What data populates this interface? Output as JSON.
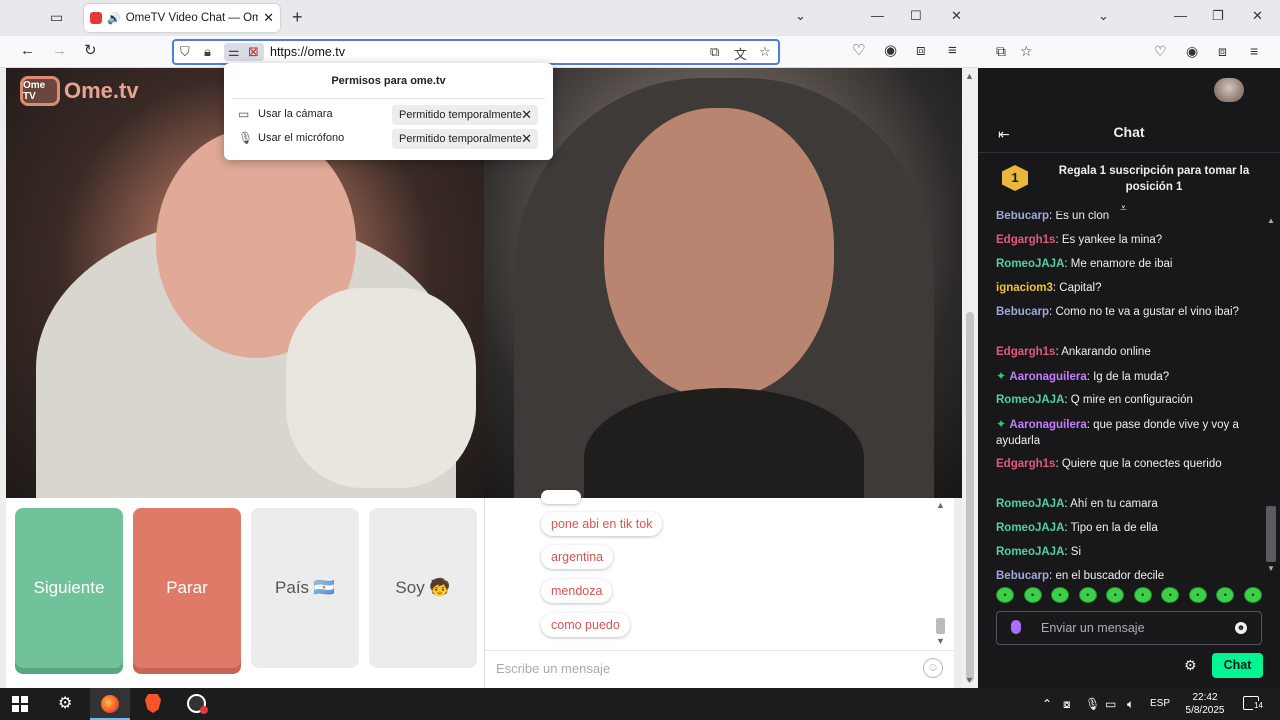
{
  "browser": {
    "tab_title": "OmeTV Video Chat — Ome",
    "url": "https://ome.tv"
  },
  "permissions_popup": {
    "title": "Permisos para ome.tv",
    "rows": [
      {
        "label": "Usar la cámara",
        "state": "Permitido temporalmente"
      },
      {
        "label": "Usar el micrófono",
        "state": "Permitido temporalmente"
      }
    ]
  },
  "ome": {
    "logo_badge": "Ome TV",
    "logo_text": "Ome.tv",
    "buttons": {
      "next": "Siguiente",
      "stop": "Parar",
      "country": "País 🇦🇷",
      "me": "Soy 🧒"
    },
    "chat_messages": [
      "pone abi en tik tok",
      "argentina",
      "mendoza",
      "como puedo"
    ],
    "chat_placeholder": "Escribe un mensaje"
  },
  "stream_chat": {
    "title": "Chat",
    "sub_banner_rank": "1",
    "sub_banner_text": "Regala 1 suscripción para tomar la posición 1",
    "messages": [
      {
        "user": "Bebucarp",
        "text": "Es un clon",
        "color": "#9fa8da",
        "badge": false
      },
      {
        "user": "Edgargh1s",
        "text": "Es yankee la mina?",
        "color": "#e05a7a",
        "badge": false
      },
      {
        "user": "RomeoJAJA",
        "text": "Me enamore de ibai",
        "color": "#4fd1a5",
        "badge": false
      },
      {
        "user": "ignaciom3",
        "text": "Capital?",
        "color": "#f1c232",
        "badge": false
      },
      {
        "user": "Bebucarp",
        "text": "Como no te va a gustar el vino ibai?",
        "color": "#9fa8da",
        "badge": false
      },
      {
        "user": "Edgargh1s",
        "text": "Ankarando online",
        "color": "#e05a7a",
        "badge": false
      },
      {
        "user": "Aaronaguilera",
        "text": "Ig de la muda?",
        "color": "#c77dff",
        "badge": true
      },
      {
        "user": "RomeoJAJA",
        "text": "Q mire en configuración",
        "color": "#4fd1a5",
        "badge": false
      },
      {
        "user": "Aaronaguilera",
        "text": "que pase donde vive y voy a ayudarla",
        "color": "#c77dff",
        "badge": true
      },
      {
        "user": "Edgargh1s",
        "text": "Quiere que la conectes querido",
        "color": "#e05a7a",
        "badge": false
      },
      {
        "user": "RomeoJAJA",
        "text": "Ahí en tu camara",
        "color": "#4fd1a5",
        "badge": false
      },
      {
        "user": "RomeoJAJA",
        "text": "Tipo en la de ella",
        "color": "#4fd1a5",
        "badge": false
      },
      {
        "user": "RomeoJAJA",
        "text": "Si",
        "color": "#4fd1a5",
        "badge": false
      },
      {
        "user": "Bebucarp",
        "text": "en el buscador decile",
        "color": "#9fa8da",
        "badge": false
      }
    ],
    "input_placeholder": "Enviar un mensaje",
    "send_label": "Chat"
  },
  "taskbar": {
    "language": "ESP",
    "time": "22:42",
    "date": "5/8/2025",
    "notifications": "14"
  }
}
